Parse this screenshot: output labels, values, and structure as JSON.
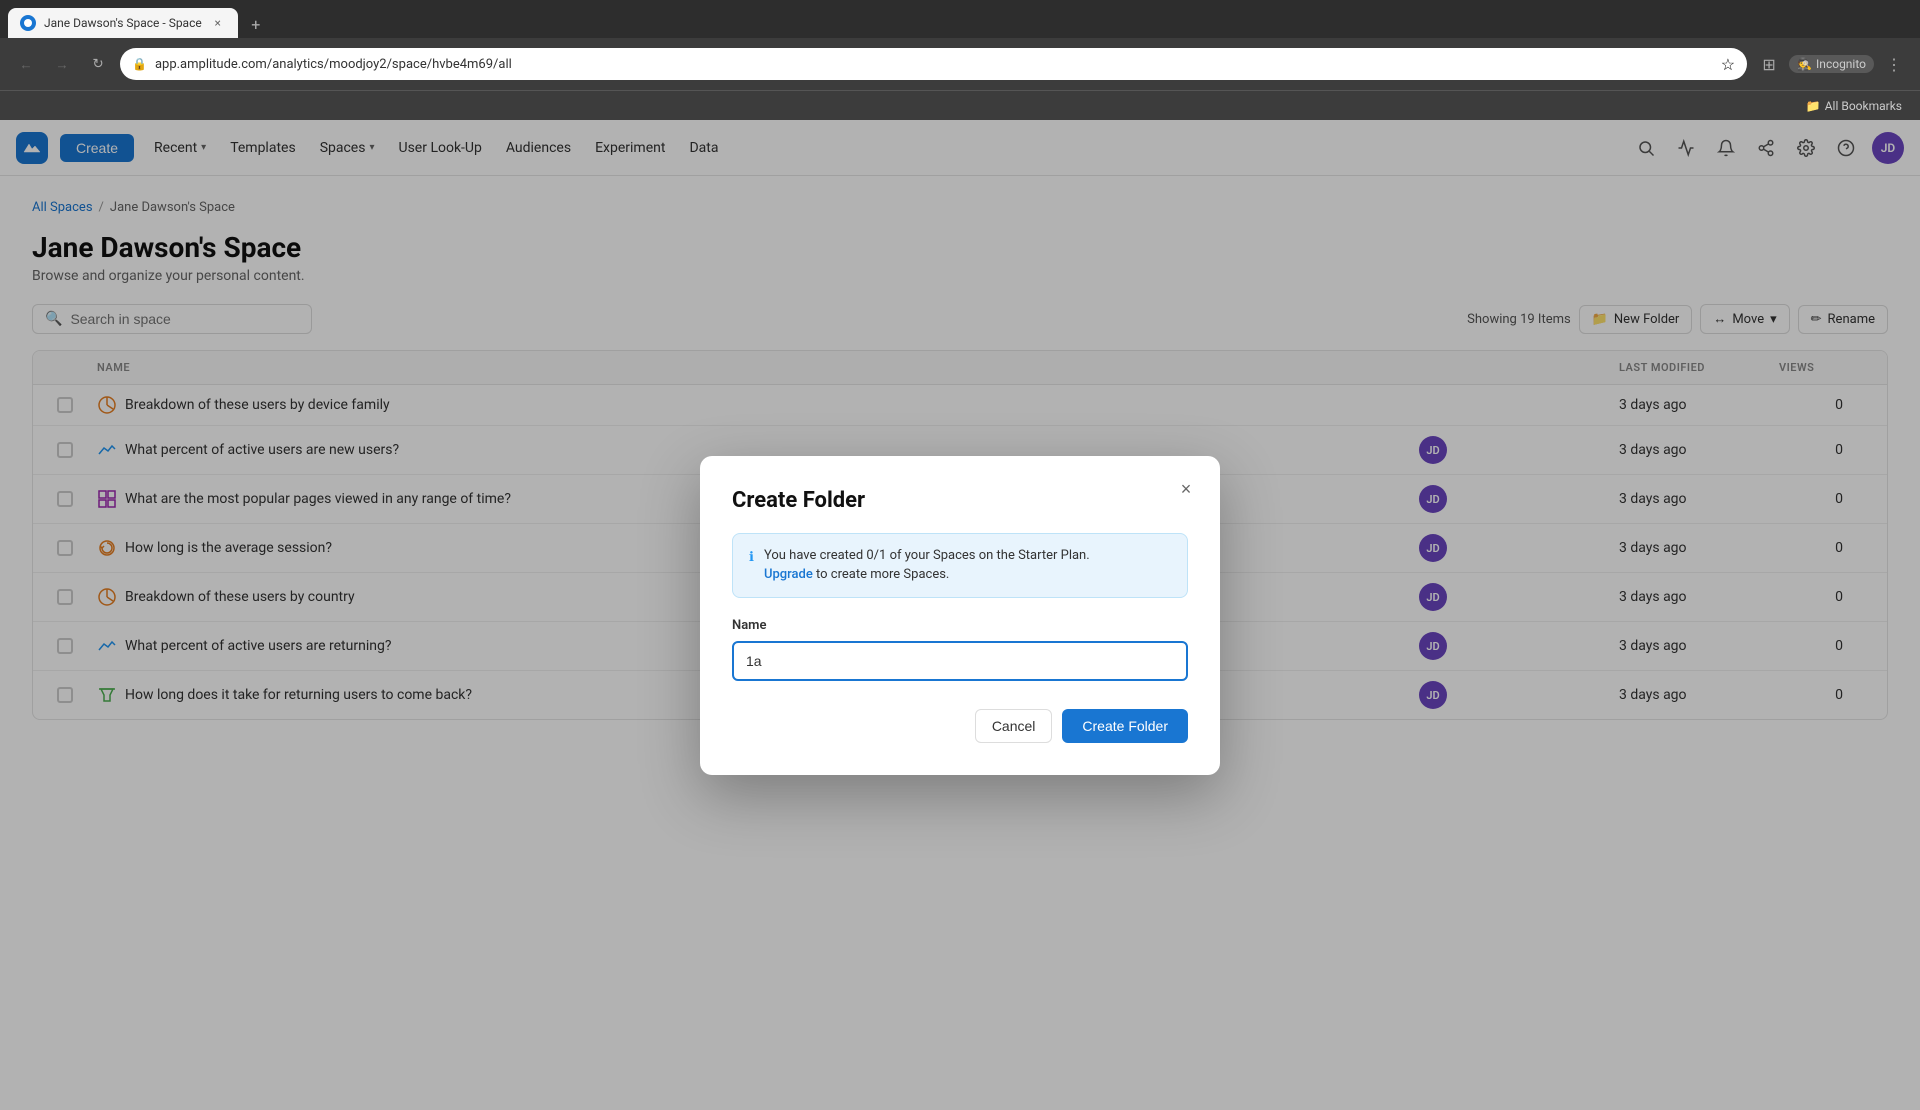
{
  "browser": {
    "tab_title": "Jane Dawson's Space - Space",
    "url": "app.amplitude.com/analytics/moodjoy2/space/hvbe4m69/all",
    "bookmarks_label": "All Bookmarks",
    "incognito": "Incognito"
  },
  "nav": {
    "create_label": "Create",
    "items": [
      {
        "label": "Recent",
        "has_chevron": true
      },
      {
        "label": "Templates",
        "has_chevron": false
      },
      {
        "label": "Spaces",
        "has_chevron": true
      },
      {
        "label": "User Look-Up",
        "has_chevron": false
      },
      {
        "label": "Audiences",
        "has_chevron": false
      },
      {
        "label": "Experiment",
        "has_chevron": false
      },
      {
        "label": "Data",
        "has_chevron": false
      }
    ],
    "user_initials": "JD"
  },
  "page": {
    "breadcrumb_spaces": "All Spaces",
    "breadcrumb_sep": "/",
    "breadcrumb_current": "Jane Dawson's Space",
    "title": "Jane Dawson's Space",
    "subtitle": "Browse and organize your personal content.",
    "search_placeholder": "Search in space",
    "showing_text": "Showing 19 Items",
    "new_folder_label": "New Folder",
    "move_label": "Move",
    "rename_label": "Rename"
  },
  "table": {
    "columns": [
      "NAME",
      "LAST MODIFIED",
      "VIEWS"
    ],
    "rows": [
      {
        "icon": "segment",
        "name": "Breakdown of these users by device family",
        "last_modified": "3 days ago",
        "views": "0",
        "has_avatar": false
      },
      {
        "icon": "trend",
        "name": "What percent of active users are new users?",
        "last_modified": "3 days ago",
        "views": "0",
        "has_avatar": true
      },
      {
        "icon": "grid",
        "name": "What are the most popular pages viewed in any range of time?",
        "last_modified": "3 days ago",
        "views": "0",
        "has_avatar": true
      },
      {
        "icon": "refresh",
        "name": "How long is the average session?",
        "last_modified": "3 days ago",
        "views": "0",
        "has_avatar": true
      },
      {
        "icon": "segment",
        "name": "Breakdown of these users by country",
        "last_modified": "3 days ago",
        "views": "0",
        "has_avatar": true
      },
      {
        "icon": "trend",
        "name": "What percent of active users are returning?",
        "last_modified": "3 days ago",
        "views": "0",
        "has_avatar": true
      },
      {
        "icon": "funnel",
        "name": "How long does it take for returning users to come back?",
        "last_modified": "3 days ago",
        "views": "0",
        "has_avatar": true
      }
    ],
    "avatar_initials": "JD"
  },
  "modal": {
    "title": "Create Folder",
    "info_text": "You have created 0/1 of your Spaces on the Starter Plan.",
    "upgrade_label": "Upgrade",
    "upgrade_suffix": " to create more Spaces.",
    "name_label": "Name",
    "name_value": "1a",
    "cancel_label": "Cancel",
    "submit_label": "Create Folder"
  }
}
